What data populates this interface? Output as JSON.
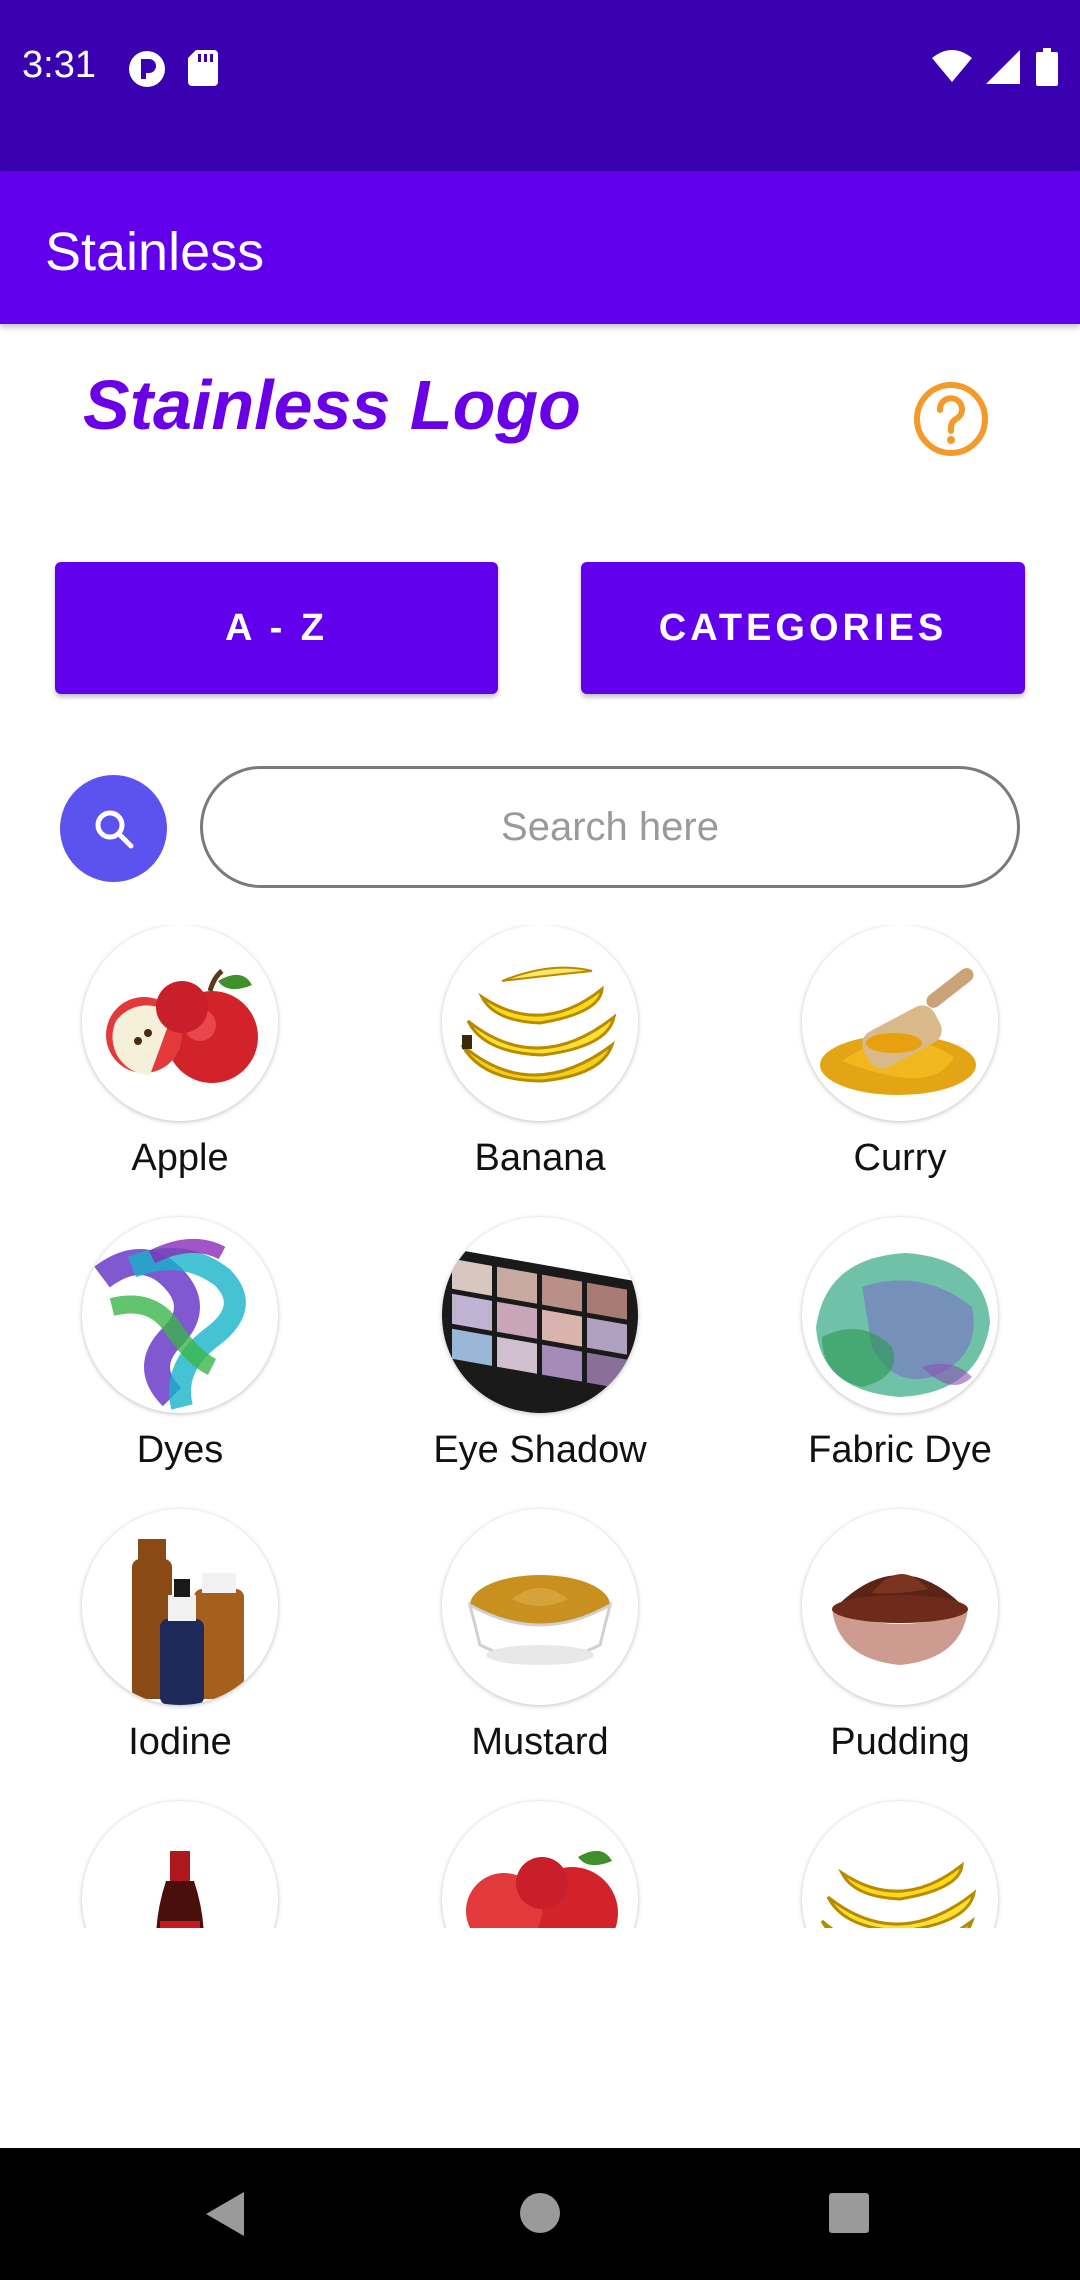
{
  "status": {
    "time": "3:31"
  },
  "app": {
    "title": "Stainless"
  },
  "logo": {
    "text": "Stainless Logo"
  },
  "buttons": {
    "az": "A - Z",
    "categories": "CATEGORIES"
  },
  "search": {
    "placeholder": "Search here",
    "value": ""
  },
  "items": [
    {
      "label": "Apple",
      "icon": "apple"
    },
    {
      "label": "Banana",
      "icon": "banana"
    },
    {
      "label": "Curry",
      "icon": "curry"
    },
    {
      "label": "Dyes",
      "icon": "dyes"
    },
    {
      "label": "Eye Shadow",
      "icon": "eye-shadow"
    },
    {
      "label": "Fabric Dye",
      "icon": "fabric-dye"
    },
    {
      "label": "Iodine",
      "icon": "iodine"
    },
    {
      "label": "Mustard",
      "icon": "mustard"
    },
    {
      "label": "Pudding",
      "icon": "pudding"
    },
    {
      "label": "",
      "icon": "cola"
    },
    {
      "label": "",
      "icon": "apple"
    },
    {
      "label": "",
      "icon": "banana"
    }
  ],
  "colors": {
    "status_bar": "#3a01b0",
    "app_bar": "#6200ee",
    "logo": "#6a00e5",
    "help": "#f39a2b",
    "search_button": "#5b52f0"
  }
}
